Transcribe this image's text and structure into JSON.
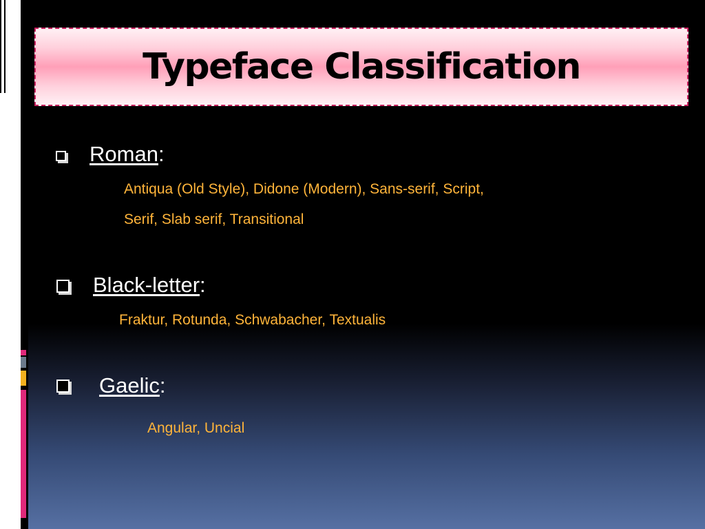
{
  "title": "Typeface Classification",
  "sections": [
    {
      "heading": "Roman",
      "punct": ":",
      "lines": [
        "Antiqua (Old Style), Didone (Modern), Sans-serif, Script,",
        "Serif, Slab serif, Transitional"
      ]
    },
    {
      "heading": "Black-letter",
      "punct": ":",
      "lines": [
        "Fraktur, Rotunda, Schwabacher, Textualis"
      ]
    },
    {
      "heading": "Gaelic",
      "punct": ":",
      "lines": [
        "Angular, Uncial"
      ]
    }
  ],
  "colors": {
    "heading_text": "#ffffff",
    "sub_text": "#ffb43a",
    "title_border": "#c8205e",
    "accent_pink": "#e0287a",
    "accent_gold": "#f2b01e",
    "accent_gray": "#6b7a8c"
  },
  "icons": {
    "bullet": "square-checkbox-bullet-icon"
  }
}
